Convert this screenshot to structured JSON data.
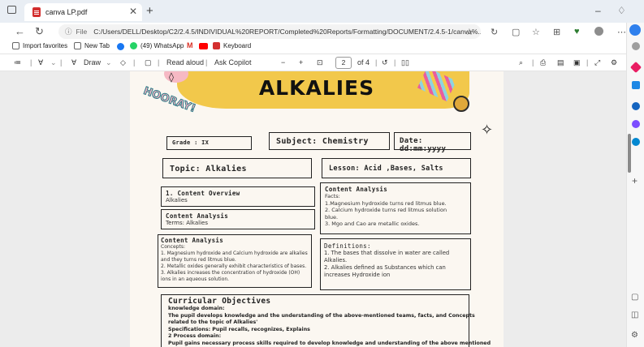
{
  "browser": {
    "tab_title": "canva LP.pdf",
    "url_label": "File",
    "url": "C:/Users/DELL/Desktop/C2/2.4.5/INDIVIDUAL%20REPORT/Completed%20Reports/Formatting/DOCUMENT/2.4.5-1/canva%..."
  },
  "favorites": [
    {
      "label": "Import favorites"
    },
    {
      "label": "New Tab"
    },
    {
      "label": "(49) WhatsApp"
    },
    {
      "label": "Keyboard"
    }
  ],
  "pdf_toolbar": {
    "draw": "Draw",
    "read_aloud": "Read aloud",
    "ask_copilot": "Ask Copilot",
    "page_current": "2",
    "page_total": "of 4"
  },
  "doc": {
    "title": "ALKALIES",
    "hooray": "HOORAY!",
    "grade": "Grade : IX",
    "subject": "Subject: Chemistry",
    "date": "Date: dd:mm:yyyy",
    "topic": "Topic: Alkalies",
    "lesson": "Lesson: Acid ,Bases, Salts",
    "overview_title": "1. Content Overview",
    "overview_text": "Alkalies",
    "analysis1_title": "Content Analysis",
    "analysis1_text": "Terms: Alkalies",
    "analysis2_title": "Content Analysis",
    "analysis2_lines": [
      "Concepts:",
      "1. Magnesium hydroxide and Calcium hydroxide are alkalies",
      "and they turns red litmus blue.",
      "2. Metallic oxides generally exhibit characteristics of bases.",
      "3. Alkalies increases the concentration of hydroxide (OH)",
      "ions in an aqueous solution."
    ],
    "analysis3_title": "Content Analysis",
    "analysis3_lines": [
      "Facts:",
      "1.Magnesium hydroxide turns red litmus blue.",
      "2. Calcium hydroxide turns red litmus solution",
      "blue.",
      "3. Mgo and Cao are metallic oxides."
    ],
    "definitions_title": "Definitions:",
    "definitions_lines": [
      "1. The bases that dissolve in water are called",
      "Alkalies.",
      "2. Alkalies defined as Substances which can",
      "increases Hydroxide ion"
    ],
    "objectives_title": "Curricular Objectives",
    "objectives_lines": [
      "knowledge domain:",
      "The pupil develops knowledge and  the understanding of the above-mentioned teams, facts, and Concepts",
      "related  to the topic of Alkalies'",
      "Specifications: Pupil recalls, recognizes, Explains",
      "2 Process domain:",
      "Pupil gains necessary process skills required to develop knowledge and understanding of the above mentioned"
    ]
  }
}
